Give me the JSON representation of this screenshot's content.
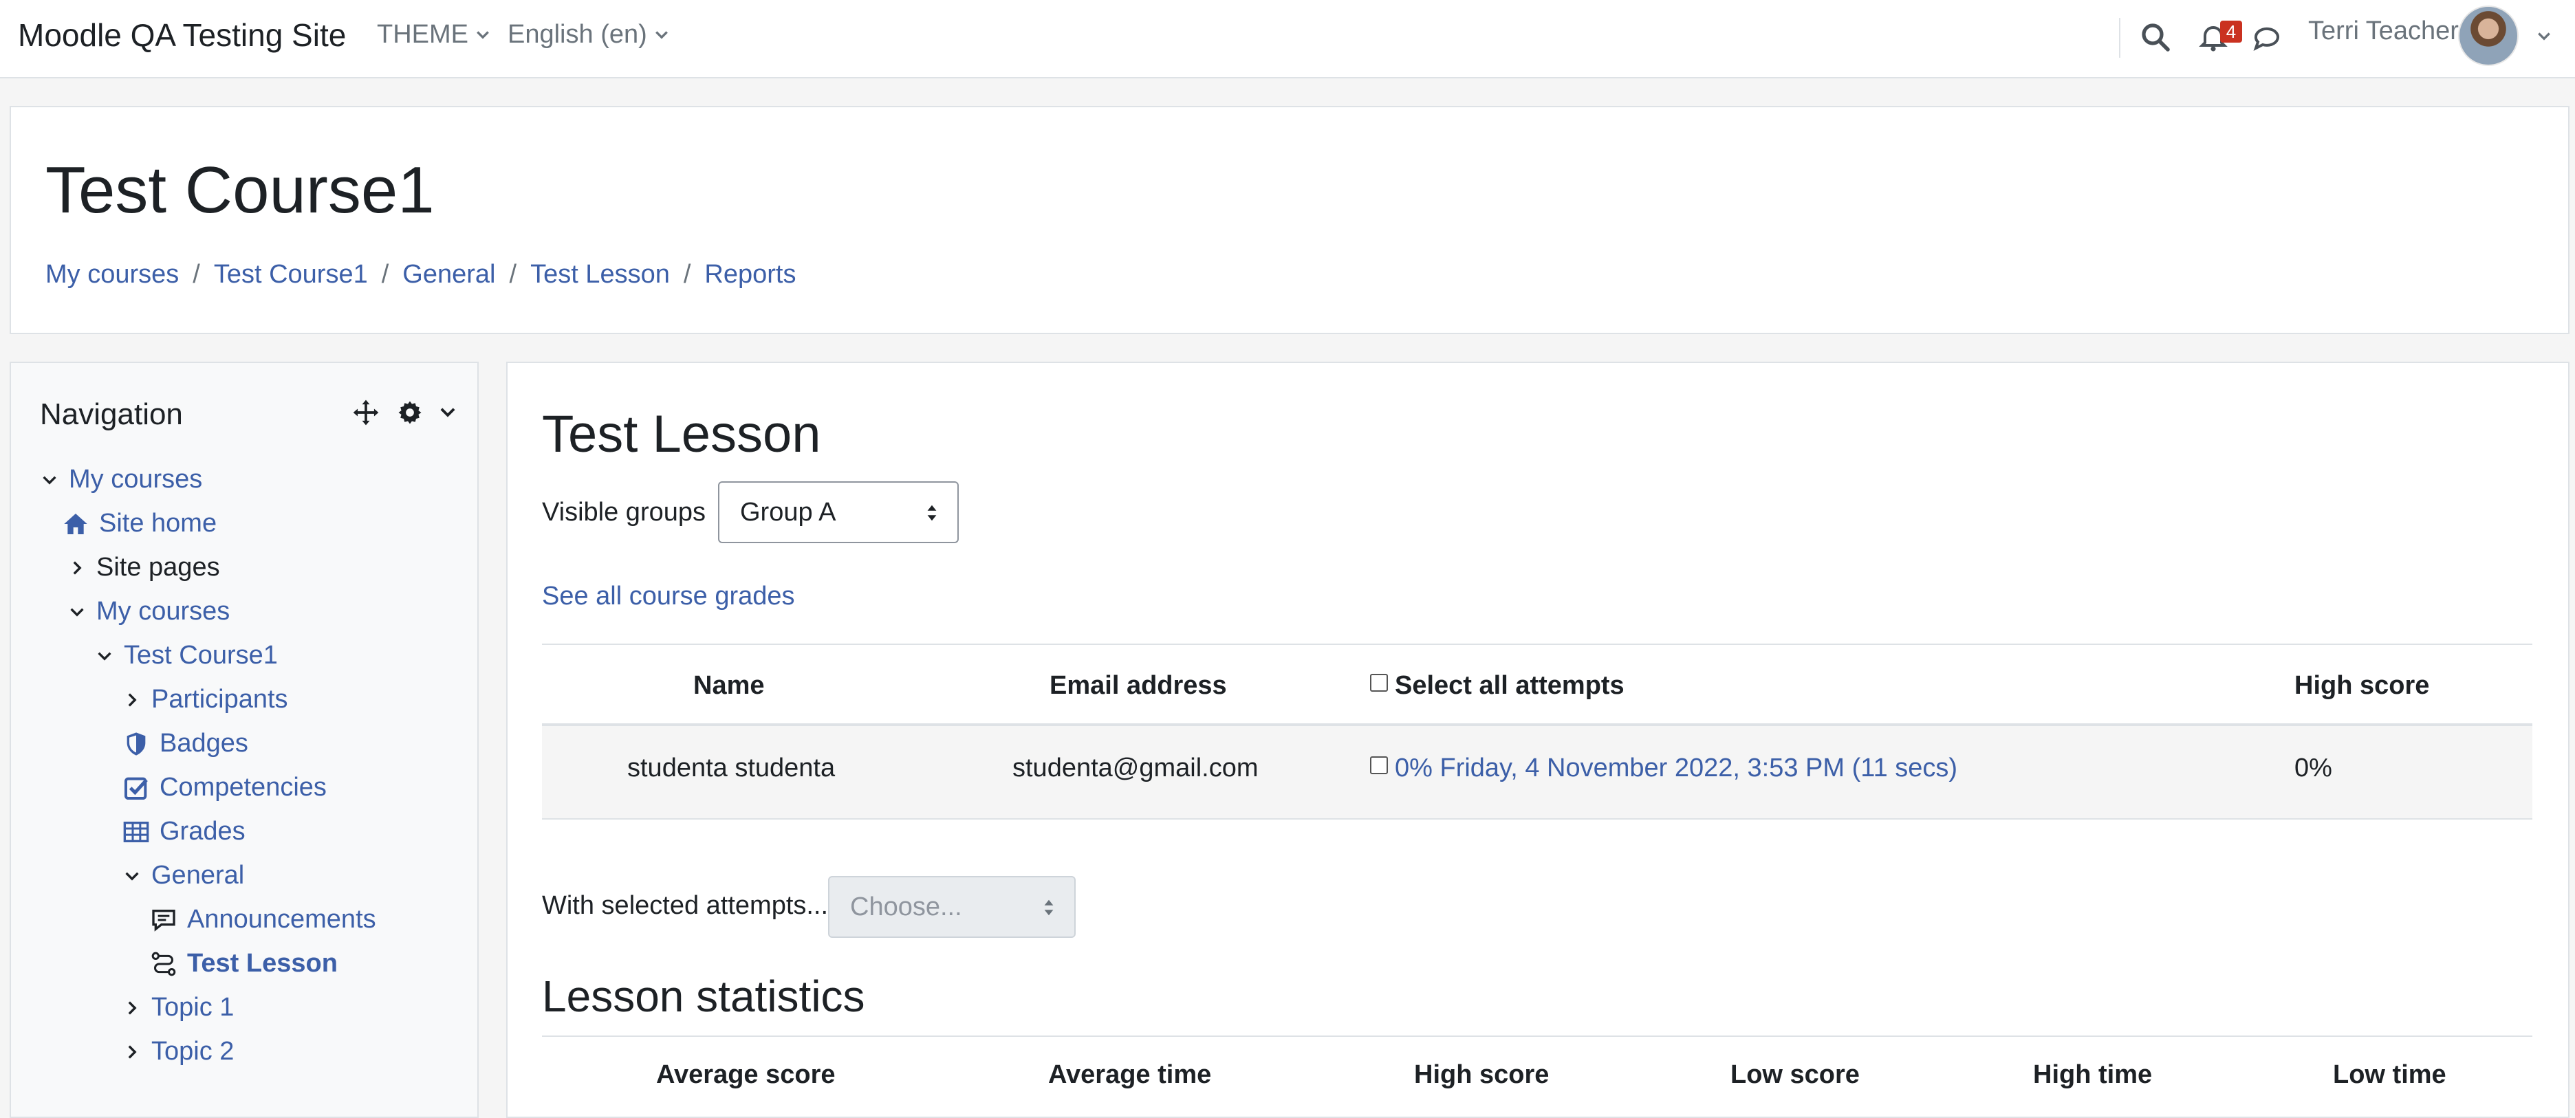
{
  "navbar": {
    "site_name": "Moodle QA Testing Site",
    "theme_menu": "THEME",
    "language_menu": "English (en)",
    "notification_count": "4",
    "user_name": "Terri Teacher"
  },
  "header": {
    "course_title": "Test Course1",
    "breadcrumbs": [
      "My courses",
      "Test Course1",
      "General",
      "Test Lesson",
      "Reports"
    ],
    "separator": "/"
  },
  "navigation": {
    "title": "Navigation",
    "items": [
      {
        "label": "My courses",
        "icon": "chevron-down-icon"
      },
      {
        "label": "Site home",
        "icon": "home-icon"
      },
      {
        "label": "Site pages",
        "icon": "chevron-right-icon"
      },
      {
        "label": "My courses",
        "icon": "chevron-down-icon"
      },
      {
        "label": "Test Course1",
        "icon": "chevron-down-icon"
      },
      {
        "label": "Participants",
        "icon": "chevron-right-icon"
      },
      {
        "label": "Badges",
        "icon": "shield-icon"
      },
      {
        "label": "Competencies",
        "icon": "check-square-icon"
      },
      {
        "label": "Grades",
        "icon": "table-icon"
      },
      {
        "label": "General",
        "icon": "chevron-down-icon"
      },
      {
        "label": "Announcements",
        "icon": "forum-icon"
      },
      {
        "label": "Test Lesson",
        "icon": "lesson-icon"
      },
      {
        "label": "Topic 1",
        "icon": "chevron-right-icon"
      },
      {
        "label": "Topic 2",
        "icon": "chevron-right-icon"
      }
    ]
  },
  "main": {
    "lesson_title": "Test Lesson",
    "groups_label": "Visible groups",
    "groups_selected": "Group A",
    "see_all_grades": "See all course grades",
    "table": {
      "headers": {
        "name": "Name",
        "email": "Email address",
        "select_all": "Select all attempts",
        "high_score": "High score"
      },
      "rows": [
        {
          "name": "studenta studenta",
          "email": "studenta@gmail.com",
          "attempt": "0% Friday, 4 November 2022, 3:53 PM (11 secs)",
          "high_score": "0%"
        }
      ]
    },
    "with_selected_label": "With selected attempts...",
    "with_selected_placeholder": "Choose...",
    "stats_title": "Lesson statistics",
    "stats_headers": [
      "Average score",
      "Average time",
      "High score",
      "Low score",
      "High time",
      "Low time"
    ]
  }
}
